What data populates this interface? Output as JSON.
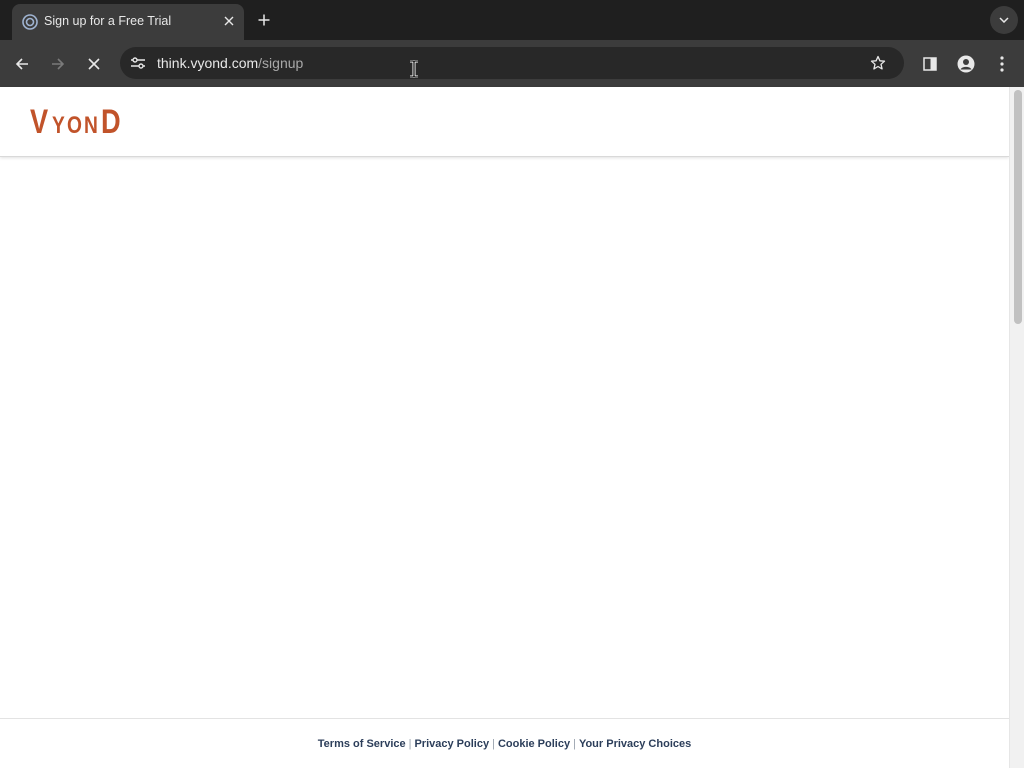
{
  "browser": {
    "tab": {
      "title": "Sign up for a Free Trial",
      "favicon": "vyond-favicon-icon"
    },
    "icons": {
      "close_tab": "close-icon",
      "new_tab": "plus-icon",
      "tab_search": "chevron-down-icon",
      "back": "back-arrow-icon",
      "forward": "forward-arrow-icon",
      "stop": "stop-loading-icon",
      "site_info": "tune-icon",
      "bookmark": "star-icon",
      "side_panel": "side-panel-icon",
      "profile": "profile-icon",
      "menu": "kebab-menu-icon"
    },
    "address_bar": {
      "host": "think.vyond.com",
      "path": "/signup"
    }
  },
  "page": {
    "logo": {
      "letters": [
        "V",
        "Y",
        "O",
        "N",
        "D"
      ],
      "text": "VYOND",
      "color": "#c1532a"
    },
    "footer": {
      "links": [
        {
          "label": "Terms of Service"
        },
        {
          "label": "Privacy Policy"
        },
        {
          "label": "Cookie Policy"
        },
        {
          "label": "Your Privacy Choices"
        }
      ],
      "separator": "|",
      "link_color": "#2c3e5a"
    }
  }
}
